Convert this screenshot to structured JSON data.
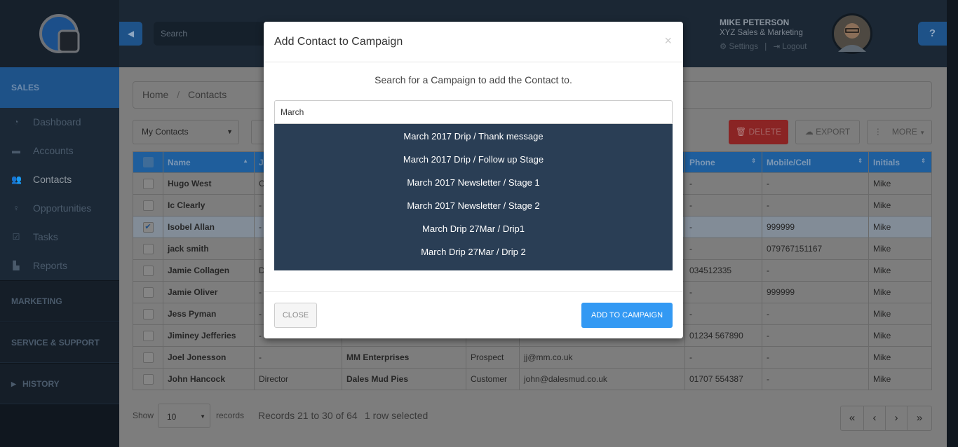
{
  "sidebar": {
    "sections": {
      "sales": "SALES",
      "marketing": "MARKETING",
      "service": "SERVICE & SUPPORT",
      "history": "HISTORY"
    },
    "items": [
      {
        "label": "Dashboard",
        "icon": "dashboard-icon"
      },
      {
        "label": "Accounts",
        "icon": "briefcase-icon"
      },
      {
        "label": "Contacts",
        "icon": "users-icon"
      },
      {
        "label": "Opportunities",
        "icon": "lightbulb-icon"
      },
      {
        "label": "Tasks",
        "icon": "checkbox-icon"
      },
      {
        "label": "Reports",
        "icon": "reports-icon"
      }
    ],
    "active": "Contacts"
  },
  "header": {
    "search_placeholder": "Search",
    "user_name": "MIKE PETERSON",
    "company": "XYZ Sales & Marketing",
    "settings": "Settings",
    "separator": "|",
    "logout": "Logout",
    "help": "?"
  },
  "breadcrumb": {
    "home": "Home",
    "sep": "/",
    "current": "Contacts"
  },
  "toolbar": {
    "filter": "My Contacts",
    "delete": "DELETE",
    "export": "EXPORT",
    "more": "MORE"
  },
  "table": {
    "headers": [
      "Name",
      "Jo",
      "",
      "",
      "",
      "Phone",
      "Mobile/Cell",
      "Initials"
    ],
    "rows": [
      {
        "c": [
          "Hugo West",
          "C",
          "",
          "",
          "",
          "-",
          "-",
          "Mike"
        ],
        "checked": false
      },
      {
        "c": [
          "Ic Clearly",
          "-",
          "",
          "",
          "",
          "-",
          "-",
          "Mike"
        ],
        "checked": false
      },
      {
        "c": [
          "Isobel Allan",
          "-",
          "",
          "",
          "",
          "-",
          "999999",
          "Mike"
        ],
        "checked": true
      },
      {
        "c": [
          "jack smith",
          "-",
          "",
          "",
          "",
          "-",
          "079767151167",
          "Mike"
        ],
        "checked": false
      },
      {
        "c": [
          "Jamie Collagen",
          "D",
          "",
          "",
          "",
          "034512335",
          "-",
          "Mike"
        ],
        "checked": false
      },
      {
        "c": [
          "Jamie Oliver",
          "-",
          "",
          "",
          "",
          "-",
          "999999",
          "Mike"
        ],
        "checked": false
      },
      {
        "c": [
          "Jess Pyman",
          "-",
          "",
          "",
          "",
          "-",
          "-",
          "Mike"
        ],
        "checked": false
      },
      {
        "c": [
          "Jiminey Jefferies",
          "-",
          "",
          "",
          "",
          "01234 567890",
          "-",
          "Mike"
        ],
        "checked": false
      },
      {
        "c": [
          "Joel Jonesson",
          "-",
          "MM Enterprises",
          "Prospect",
          "jj@mm.co.uk",
          "-",
          "-",
          "Mike"
        ],
        "checked": false
      },
      {
        "c": [
          "John Hancock",
          "Director",
          "Dales Mud Pies",
          "Customer",
          "john@dalesmud.co.uk",
          "01707 554387",
          "-",
          "Mike"
        ],
        "checked": false
      }
    ]
  },
  "footer": {
    "show": "Show",
    "page_size": "10",
    "records": "records",
    "range": "Records 21 to 30 of 64",
    "selected": "1 row selected"
  },
  "pagination": {
    "first": "«",
    "prev": "‹",
    "next": "›",
    "last": "»"
  },
  "modal": {
    "title": "Add Contact to Campaign",
    "close_x": "×",
    "instruction": "Search for a Campaign to add the Contact to.",
    "search_value": "March",
    "options": [
      "March 2017 Drip / Thank message",
      "March 2017 Drip / Follow up Stage",
      "March 2017 Newsletter / Stage 1",
      "March 2017 Newsletter / Stage 2",
      "March Drip 27Mar / Drip1",
      "March Drip 27Mar / Drip 2"
    ],
    "close": "CLOSE",
    "add": "ADD TO CAMPAIGN"
  },
  "colors": {
    "accent": "#3399f3",
    "dropdown_bg": "#2a3e55",
    "delete": "#8a2424"
  }
}
